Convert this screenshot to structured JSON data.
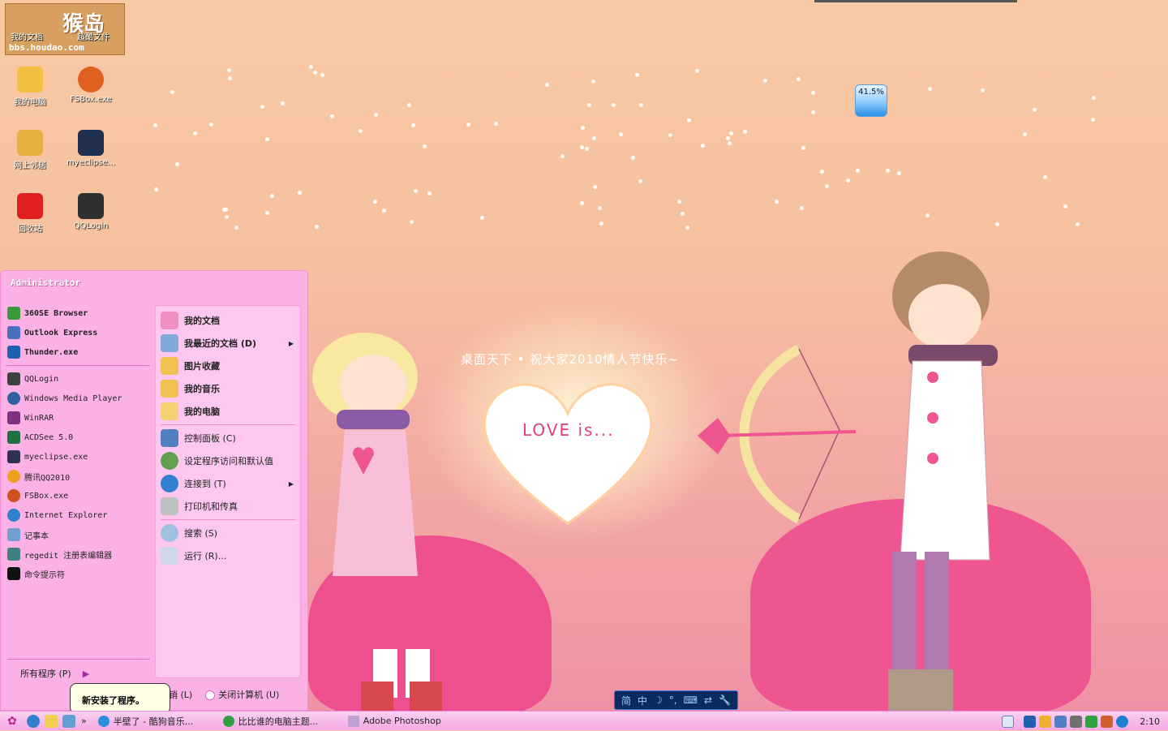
{
  "watermark": {
    "big": "猴岛",
    "site": "bbs.houdao.com",
    "icon_labels": [
      "我的文档",
      "超酷文件"
    ]
  },
  "desktop_icons": [
    {
      "label": "我的电脑",
      "icon": "computer-icon"
    },
    {
      "label": "FSBox.exe",
      "icon": "basketball-icon"
    },
    {
      "label": "网上邻居",
      "icon": "network-icon"
    },
    {
      "label": "myeclipse...",
      "icon": "eclipse-icon"
    },
    {
      "label": "回收站",
      "icon": "recycle-bin-icon"
    },
    {
      "label": "QQLogin",
      "icon": "qq-game-icon"
    }
  ],
  "widget": {
    "percent": "41.5%"
  },
  "wallpaper": {
    "caption": "桌面天下 • 祝大家2010情人节快乐~",
    "love": "LOVE is..."
  },
  "start_menu": {
    "user": "Administrator",
    "pinned": [
      {
        "label": "360SE Browser",
        "icon": "360se-icon"
      },
      {
        "label": "Outlook Express",
        "icon": "outlook-icon"
      },
      {
        "label": "Thunder.exe",
        "icon": "thunder-icon"
      }
    ],
    "recent": [
      {
        "label": "QQLogin",
        "icon": "qqlogin-icon"
      },
      {
        "label": "Windows Media Player",
        "icon": "media-player-icon"
      },
      {
        "label": "WinRAR",
        "icon": "winrar-icon"
      },
      {
        "label": "ACDSee 5.0",
        "icon": "acdsee-icon"
      },
      {
        "label": "myeclipse.exe",
        "icon": "myeclipse-icon"
      },
      {
        "label": "腾讯QQ2010",
        "icon": "qq-icon"
      },
      {
        "label": "FSBox.exe",
        "icon": "fsbox-icon"
      },
      {
        "label": "Internet Explorer",
        "icon": "ie-icon"
      },
      {
        "label": "记事本",
        "icon": "notepad-icon"
      },
      {
        "label": "regedit 注册表编辑器",
        "icon": "regedit-icon"
      },
      {
        "label": "命令提示符",
        "icon": "cmd-icon"
      }
    ],
    "all_programs": "所有程序 (P)",
    "right": [
      {
        "label": "我的文档",
        "icon": "my-documents-icon",
        "bold": true
      },
      {
        "label": "我最近的文档 (D)",
        "icon": "recent-docs-icon",
        "bold": true,
        "arrow": "▶"
      },
      {
        "label": "图片收藏",
        "icon": "pictures-icon",
        "bold": true
      },
      {
        "label": "我的音乐",
        "icon": "music-icon",
        "bold": true
      },
      {
        "label": "我的电脑",
        "icon": "my-computer-icon",
        "bold": true
      },
      {
        "label": "控制面板 (C)",
        "icon": "control-panel-icon"
      },
      {
        "label": "设定程序访问和默认值",
        "icon": "defaults-icon"
      },
      {
        "label": "连接到 (T)",
        "icon": "connect-icon",
        "arrow": "▶"
      },
      {
        "label": "打印机和传真",
        "icon": "printer-icon"
      },
      {
        "label": "搜索 (S)",
        "icon": "search-icon"
      },
      {
        "label": "运行 (R)...",
        "icon": "run-icon"
      }
    ],
    "logoff": "注销 (L)",
    "shutdown": "关闭计算机 (U)"
  },
  "balloon": "新安装了程序。",
  "ime": [
    "简",
    "中",
    "☽",
    "°,",
    "⌨",
    "⇄",
    "🔧"
  ],
  "taskbar": {
    "overflow": "»",
    "tasks": [
      {
        "label": "半壁了 - 酷狗音乐...",
        "icon": "kugou-icon"
      },
      {
        "label": "比比谁的电脑主题...",
        "icon": "browser-icon"
      },
      {
        "label": "Adobe Photoshop",
        "icon": "photoshop-icon"
      }
    ],
    "tray_icons": [
      "ime-p-icon",
      "thunder-tray-icon",
      "qq-tray-icon",
      "network-tray-icon",
      "volume-tray-icon",
      "shield-tray-icon",
      "antivirus-tray-icon",
      "close-tray-icon"
    ],
    "clock": "2:10"
  }
}
